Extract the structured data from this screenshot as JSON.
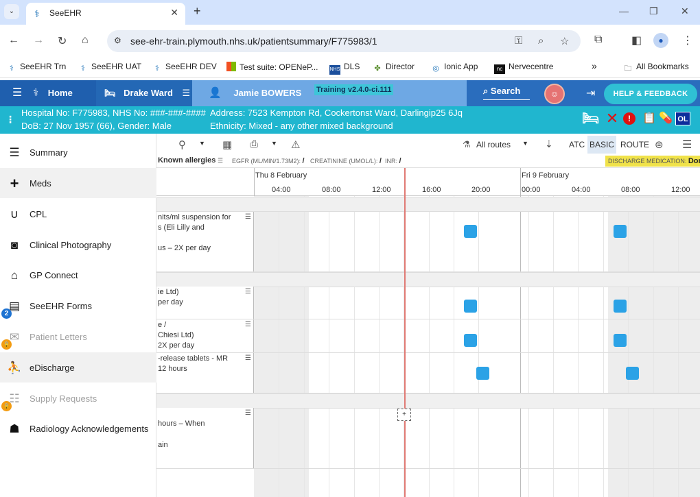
{
  "browser": {
    "tab_title": "SeeEHR",
    "url": "see-ehr-train.plymouth.nhs.uk/patientsummary/F775983/1",
    "bookmarks": [
      "SeeEHR Trn",
      "SeeEHR UAT",
      "SeeEHR DEV",
      "Test suite: OPENeP...",
      "DLS",
      "Director",
      "Ionic App",
      "Nervecentre"
    ],
    "all_bookmarks": "All Bookmarks"
  },
  "header": {
    "home": "Home",
    "ward": "Drake Ward",
    "patient_name": "Jamie BOWERS",
    "training": "Training v2.4.0-ci.111",
    "search": "Search",
    "help": "HELP & FEEDBACK"
  },
  "banner": {
    "hospital_no": "Hospital No: F775983, NHS No: ###-###-####",
    "dob": "DoB: 27 Nov 1957 (66), Gender: Male",
    "address": "Address: 7523 Kempton Rd, Cockertonst Ward, Darlingip25 6Jq",
    "ethnicity": "Ethnicity: Mixed - any other mixed background",
    "ol_badge": "OL"
  },
  "menu": [
    {
      "label": "Summary",
      "icon": "list-icon"
    },
    {
      "label": "Meds",
      "icon": "plus-icon"
    },
    {
      "label": "CPL",
      "icon": "stethoscope-icon"
    },
    {
      "label": "Clinical Photography",
      "icon": "camera-icon"
    },
    {
      "label": "GP Connect",
      "icon": "house-icon"
    },
    {
      "label": "SeeEHR Forms",
      "icon": "forms-icon",
      "badge": "2"
    },
    {
      "label": "Patient Letters",
      "icon": "letters-icon"
    },
    {
      "label": "eDischarge",
      "icon": "discharge-icon"
    },
    {
      "label": "Supply Requests",
      "icon": "supply-icon"
    },
    {
      "label": "Radiology Acknowledgements",
      "icon": "xray-icon"
    }
  ],
  "toolbar": {
    "all_routes": "All routes",
    "atc": "ATC",
    "basic": "BASIC",
    "route": "ROUTE"
  },
  "allergies": {
    "known": "Known allergies",
    "egfr": "EGFR (ML/MIN/1.73M2):",
    "egfr_value": "/",
    "creatinine": "CREATININE (UMOL/L):",
    "creatinine_value": "/",
    "inr": "INR:",
    "inr_value": "/",
    "discharge_label": "DISCHARGE MEDICATION:",
    "discharge_value": "Done"
  },
  "timeline": {
    "day1": "Thu 8 February",
    "day2": "Fri 9 February",
    "hours": [
      "04:00",
      "08:00",
      "12:00",
      "16:00",
      "20:00",
      "00:00",
      "04:00",
      "08:00",
      "12:00"
    ]
  },
  "meds": [
    {
      "lines": [
        "nits/ml suspension for",
        "s (Eli Lilly and",
        "",
        "us – 2X per day"
      ]
    },
    {
      "lines": [
        "ie Ltd)",
        "per day"
      ]
    },
    {
      "lines": [
        "e /",
        "Chiesi Ltd)",
        "2X per day"
      ]
    },
    {
      "lines": [
        "-release tablets - MR",
        "12 hours"
      ]
    },
    {
      "lines": [
        "hours – When",
        "",
        "ain"
      ]
    }
  ],
  "add_dose": "+"
}
